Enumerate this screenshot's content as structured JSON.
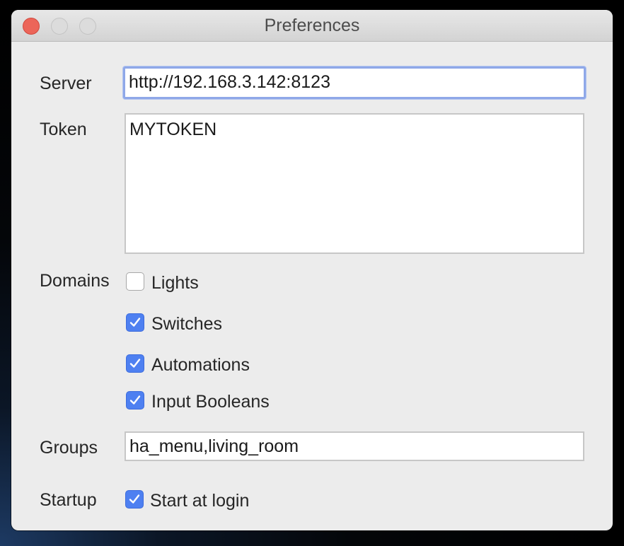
{
  "window": {
    "title": "Preferences"
  },
  "form": {
    "server": {
      "label": "Server",
      "value": "http://192.168.3.142:8123"
    },
    "token": {
      "label": "Token",
      "value": "MYTOKEN"
    },
    "domains": {
      "label": "Domains",
      "options": [
        {
          "label": "Lights",
          "checked": false
        },
        {
          "label": "Switches",
          "checked": true
        },
        {
          "label": "Automations",
          "checked": true
        },
        {
          "label": "Input Booleans",
          "checked": true
        }
      ]
    },
    "groups": {
      "label": "Groups",
      "value": "ha_menu,living_room"
    },
    "startup": {
      "label": "Startup",
      "option": {
        "label": "Start at login",
        "checked": true
      }
    }
  },
  "colors": {
    "accent": "#4e80f1",
    "focus_ring": "#8fa8e8",
    "close_button": "#ec6559",
    "window_bg": "#ececec"
  },
  "icons": {
    "close": "close-button-icon",
    "minimize": "minimize-button-icon",
    "zoom": "zoom-button-icon",
    "check": "checkmark-icon"
  }
}
